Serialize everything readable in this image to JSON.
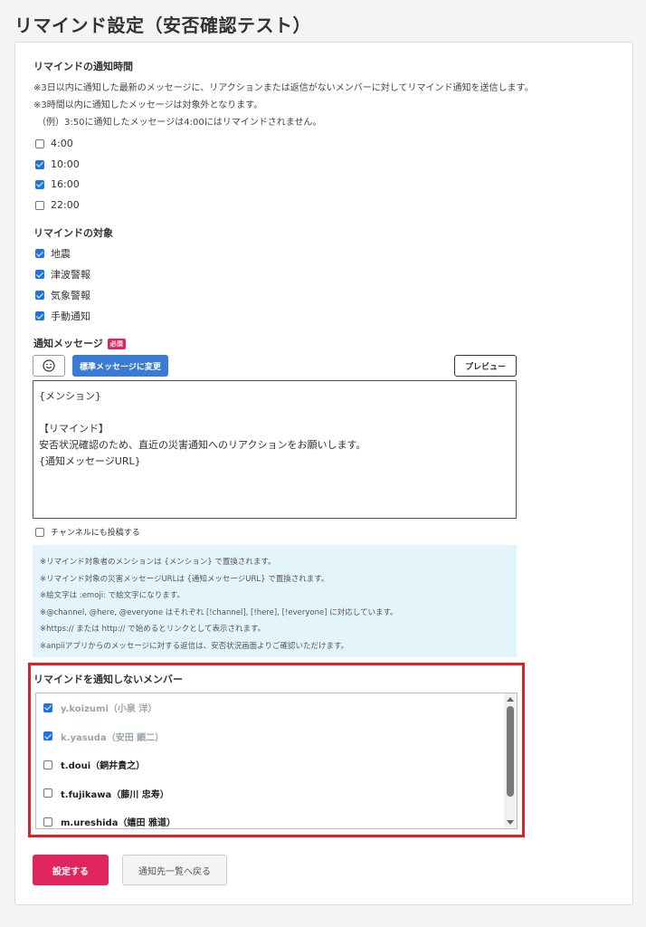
{
  "page": {
    "title": "リマインド設定（安否確認テスト）"
  },
  "notify_time": {
    "label": "リマインドの通知時間",
    "notes": [
      "※3日以内に通知した最新のメッセージに、リアクションまたは返信がないメンバーに対してリマインド通知を送信します。",
      "※3時間以内に通知したメッセージは対象外となります。",
      "（例）3:50に通知したメッセージは4:00にはリマインドされません。"
    ],
    "options": [
      {
        "label": "4:00",
        "checked": false
      },
      {
        "label": "10:00",
        "checked": true
      },
      {
        "label": "16:00",
        "checked": true
      },
      {
        "label": "22:00",
        "checked": false
      }
    ]
  },
  "targets": {
    "label": "リマインドの対象",
    "options": [
      {
        "label": "地震",
        "checked": true
      },
      {
        "label": "津波警報",
        "checked": true
      },
      {
        "label": "気象警報",
        "checked": true
      },
      {
        "label": "手動通知",
        "checked": true
      }
    ]
  },
  "message": {
    "label": "通知メッセージ",
    "required_badge": "必須",
    "emoji_icon": "smiley-icon",
    "standard_button": "標準メッセージに変更",
    "preview_button": "プレビュー",
    "body": "{メンション}\n\n【リマインド】\n安否状況確認のため、直近の災害通知へのリアクションをお願いします。\n{通知メッセージURL}",
    "channel_post_label": "チャンネルにも投稿する",
    "channel_post_checked": false,
    "info_lines": [
      "※リマインド対象者のメンションは {メンション} で置換されます。",
      "※リマインド対象の災害メッセージURLは {通知メッセージURL} で置換されます。",
      "※絵文字は :emoji: で絵文字になります。",
      "※@channel, @here, @everyone はそれぞれ [!channel], [!here], [!everyone] に対応しています。",
      "※https:// または http:// で始めるとリンクとして表示されます。",
      "※anpiiアプリからのメッセージに対する返信は、安否状況画面よりご確認いただけます。"
    ]
  },
  "exclude": {
    "label": "リマインドを通知しないメンバー",
    "members": [
      {
        "name": "y.koizumi（小泉 洋）",
        "checked": true
      },
      {
        "name": "k.yasuda（安田 顕二）",
        "checked": true
      },
      {
        "name": "t.doui（銅井貴之）",
        "checked": false
      },
      {
        "name": "t.fujikawa（藤川 忠寿）",
        "checked": false
      },
      {
        "name": "m.ureshida（嬉田 雅道）",
        "checked": false
      }
    ]
  },
  "actions": {
    "submit": "設定する",
    "back": "通知先一覧へ戻る"
  },
  "colors": {
    "primary": "#e0245e",
    "accent_blue": "#3a7bd5",
    "checkbox": "#1a73e8",
    "highlight_border": "#e01e24",
    "info_bg": "#e4f4fb"
  }
}
